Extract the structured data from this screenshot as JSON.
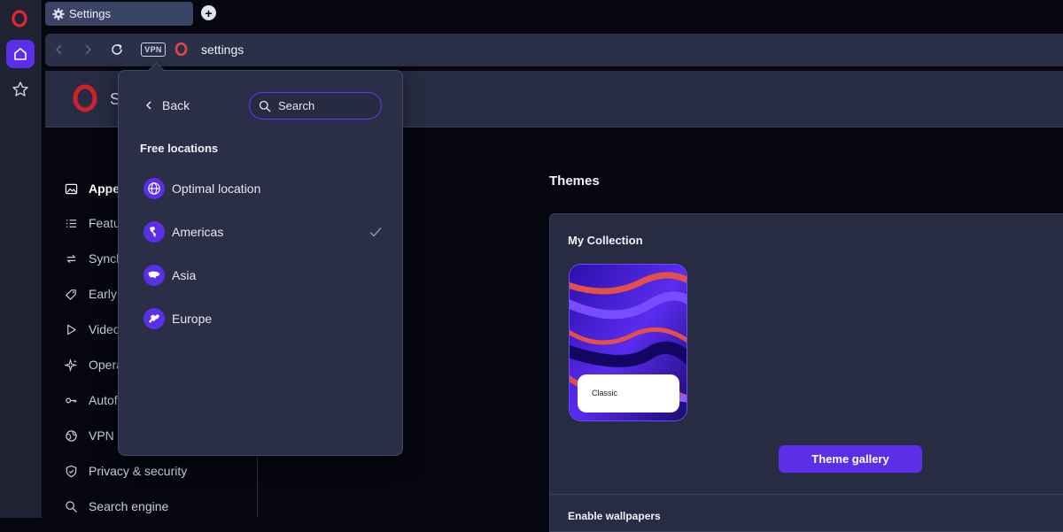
{
  "browser": {
    "tab": {
      "title": "Settings"
    },
    "address": {
      "vpn_badge": "VPN",
      "url": "settings"
    }
  },
  "page": {
    "title_partial": "S"
  },
  "sidebar": {
    "items": [
      {
        "label": "Appe",
        "icon": "image-icon",
        "active": true
      },
      {
        "label": "Featu",
        "icon": "list-icon"
      },
      {
        "label": "Synch",
        "icon": "sync-icon"
      },
      {
        "label": "Early",
        "icon": "tag-icon"
      },
      {
        "label": "Video",
        "icon": "play-icon"
      },
      {
        "label": "Opera",
        "icon": "sparkle-icon"
      },
      {
        "label": "Autof",
        "icon": "key-icon"
      },
      {
        "label": "VPN",
        "icon": "globe-icon"
      },
      {
        "label": "Privacy & security",
        "icon": "shield-icon"
      },
      {
        "label": "Search engine",
        "icon": "search-icon"
      }
    ]
  },
  "main": {
    "themes_title": "Themes",
    "collection_title": "My Collection",
    "theme_card_label": "Classic",
    "gallery_button": "Theme gallery",
    "enable_wallpapers": "Enable wallpapers"
  },
  "vpn_popup": {
    "back_label": "Back",
    "search_placeholder": "Search",
    "section_title": "Free locations",
    "locations": [
      {
        "label": "Optimal location",
        "icon": "globe-icon",
        "selected": false
      },
      {
        "label": "Americas",
        "icon": "americas-icon",
        "selected": true
      },
      {
        "label": "Asia",
        "icon": "asia-icon",
        "selected": false
      },
      {
        "label": "Europe",
        "icon": "europe-icon",
        "selected": false
      }
    ]
  },
  "colors": {
    "accent": "#5b2ee8",
    "opera_red": "#e0262f",
    "panel": "#272c42"
  }
}
